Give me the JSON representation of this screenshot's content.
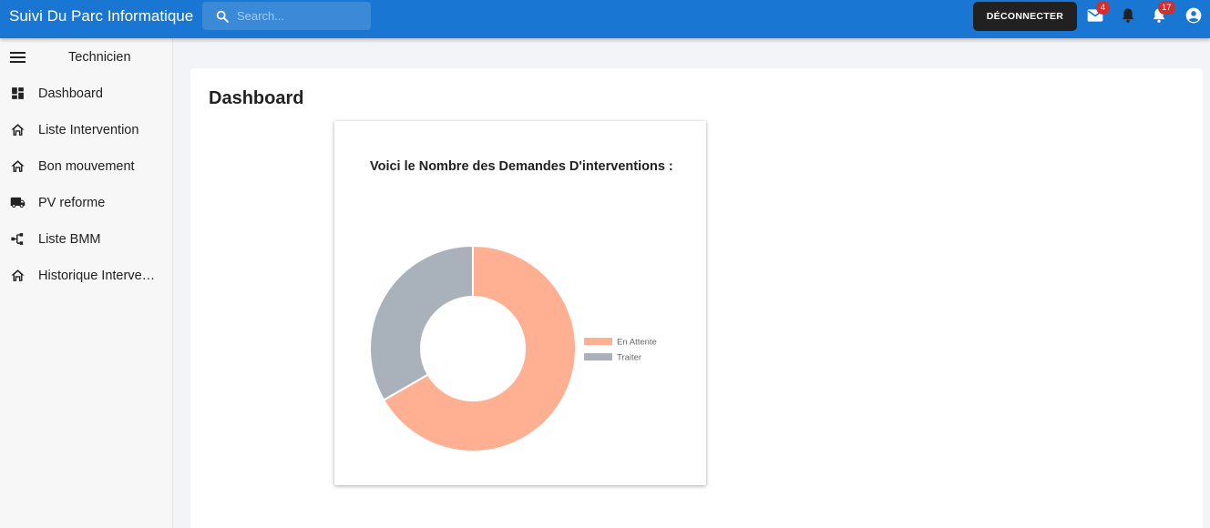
{
  "app": {
    "title": "Suivi Du Parc Informatique"
  },
  "search": {
    "placeholder": "Search..."
  },
  "header": {
    "logout_label": "DÉCONNECTER",
    "mail_badge": "4",
    "notifications_badge": "17"
  },
  "sidebar": {
    "role": "Technicien",
    "items": [
      {
        "label": "Dashboard",
        "icon": "dashboard-icon"
      },
      {
        "label": "Liste Intervention",
        "icon": "home-icon"
      },
      {
        "label": "Bon mouvement",
        "icon": "home-icon"
      },
      {
        "label": "PV reforme",
        "icon": "truck-icon"
      },
      {
        "label": "Liste BMM",
        "icon": "tree-icon"
      },
      {
        "label": "Historique Interve…",
        "icon": "home-icon"
      }
    ]
  },
  "main": {
    "title": "Dashboard"
  },
  "colors": {
    "accent": "#1976d2",
    "en_attente": "#ffb093",
    "traiter": "#a9b2bb"
  },
  "chart_data": {
    "type": "pie",
    "title": "Voici le Nombre des Demandes D'interventions :",
    "categories": [
      "En Attente",
      "Traiter"
    ],
    "values": [
      2,
      1
    ],
    "colors": [
      "#ffb093",
      "#a9b2bb"
    ],
    "legend": "right"
  }
}
